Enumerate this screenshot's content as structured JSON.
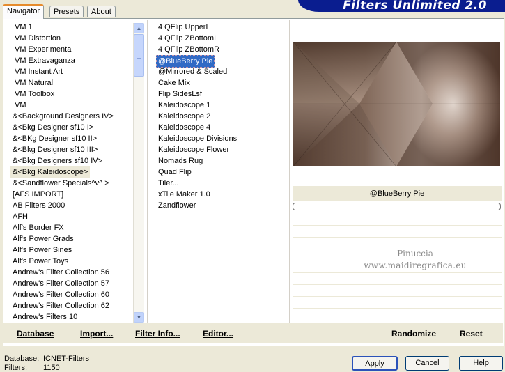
{
  "tabs": [
    {
      "label": "Navigator",
      "active": true
    },
    {
      "label": "Presets",
      "active": false
    },
    {
      "label": "About",
      "active": false
    }
  ],
  "brand": "Filters Unlimited 2.0",
  "categories": [
    "VM 1",
    "VM Distortion",
    "VM Experimental",
    "VM Extravaganza",
    "VM Instant Art",
    "VM Natural",
    "VM Toolbox",
    "VM",
    "&<Background Designers IV>",
    "&<Bkg Designer sf10 I>",
    "&<BKg Designer sf10 II>",
    "&<Bkg Designer sf10 III>",
    "&<Bkg Designers sf10 IV>",
    "&<Bkg Kaleidoscope>",
    "&<Sandflower Specials^v^ >",
    "[AFS IMPORT]",
    "AB Filters 2000",
    "AFH",
    "Alf's Border FX",
    "Alf's Power Grads",
    "Alf's Power Sines",
    "Alf's Power Toys",
    "Andrew's Filter Collection 56",
    "Andrew's Filter Collection 57",
    "Andrew's Filter Collection 60",
    "Andrew's Filter Collection 62",
    "Andrew's Filters 10"
  ],
  "selected_category": "&<Bkg Kaleidoscope>",
  "filters": [
    "4 QFlip UpperL",
    "4 QFlip ZBottomL",
    "4 QFlip ZBottomR",
    "@BlueBerry Pie",
    "@Mirrored & Scaled",
    "Cake Mix",
    "Flip SidesLsf",
    "Kaleidoscope 1",
    "Kaleidoscope 2",
    "Kaleidoscope 4",
    "Kaleidoscope Divisions",
    "Kaleidoscope Flower",
    "Nomads Rug",
    "Quad Flip",
    "Tiler...",
    "xTile Maker 1.0",
    "Zandflower"
  ],
  "selected_filter": "@BlueBerry Pie",
  "preview_filter_name": "@BlueBerry Pie",
  "watermark": {
    "line1": "Pinuccia",
    "line2": "www.maidiregrafica.eu"
  },
  "actions": {
    "database": "Database",
    "import": "Import...",
    "filter_info": "Filter Info...",
    "editor": "Editor...",
    "randomize": "Randomize",
    "reset": "Reset"
  },
  "status": {
    "database_label": "Database:",
    "database_value": "ICNET-Filters",
    "filters_label": "Filters:",
    "filters_value": "1150"
  },
  "buttons": {
    "apply": "Apply",
    "cancel": "Cancel",
    "help": "Help"
  },
  "colors": {
    "selection": "#316ac5",
    "banner": "#0a1d8f",
    "preview_dark": "#5a4235",
    "preview_light": "#efe4dc"
  }
}
